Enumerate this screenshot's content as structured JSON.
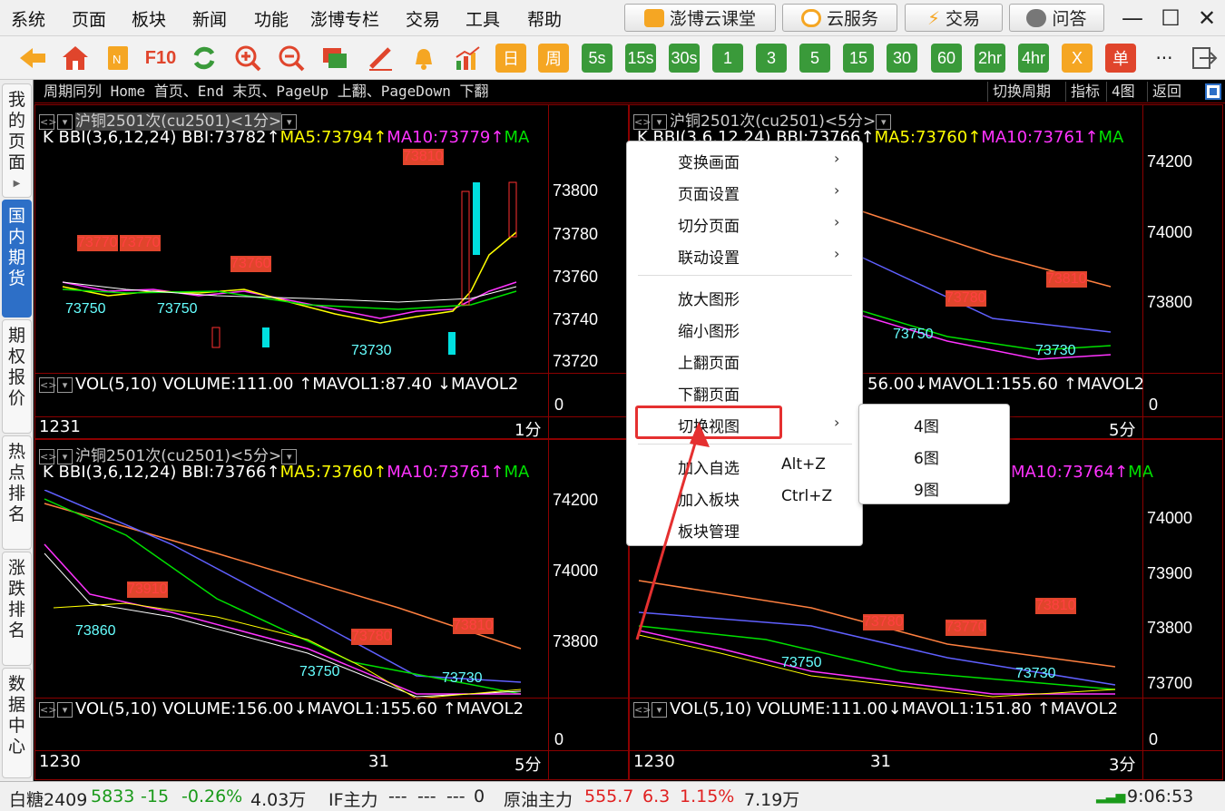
{
  "menu": [
    "系统",
    "页面",
    "板块",
    "新闻",
    "功能",
    "澎博专栏",
    "交易",
    "工具",
    "帮助"
  ],
  "topbuttons": [
    "澎博云课堂",
    "云服务",
    "交易",
    "问答"
  ],
  "toolbar": {
    "icons": [
      "back-arrow-icon",
      "home-icon",
      "notepad-icon",
      "f10-icon",
      "refresh-icon",
      "zoom-in-icon",
      "zoom-out-icon",
      "window-icon",
      "pen-icon",
      "bell-icon",
      "chart-up-icon"
    ],
    "f10": "F10",
    "periods": [
      "日",
      "周",
      "5s",
      "15s",
      "30s",
      "1",
      "3",
      "5",
      "15",
      "30",
      "60",
      "2hr",
      "4hr"
    ],
    "x": "X",
    "dan": "单",
    "more": "···"
  },
  "lefttabs": [
    "我的页面",
    "国内期货",
    "期权报价",
    "热点排名",
    "涨跌排名",
    "数据中心"
  ],
  "hint": {
    "text": "周期同列 Home 首页、End 末页、PageUp 上翻、PageDown 下翻",
    "buttons": [
      "切换周期",
      "指标",
      "4图",
      "返回"
    ]
  },
  "panels": [
    {
      "title": "沪铜2501次(cu2501)<1分>",
      "bbi": "K BBI(3,6,12,24) BBI:73782↑",
      "ma5": "MA5:73794↑",
      "ma10": "MA10:73779↑",
      "mx": "MA",
      "prices": [
        "73800",
        "73780",
        "73760",
        "73740",
        "73720"
      ],
      "labels_r": [
        "73810",
        "73770",
        "73770",
        "73760"
      ],
      "labels_c": [
        "73750",
        "73750",
        "73730"
      ],
      "vol": "VOL(5,10) VOLUME:111.00 ↑MAVOL1:87.40 ↓MAVOL2",
      "vzero": "0",
      "date": "1231",
      "period": "1分"
    },
    {
      "title": "沪铜2501次(cu2501)<5分>",
      "bbi": "K BBI(3,6,12,24) BBI:73766↑",
      "ma5": "MA5:73760↑",
      "ma10": "MA10:73761↑",
      "mx": "MA",
      "prices": [
        "74200",
        "74000",
        "73800"
      ],
      "labels_r": [
        "73780",
        "73810"
      ],
      "labels_c": [
        "73750",
        "73730"
      ],
      "vol": "56.00↓MAVOL1:155.60 ↑MAVOL2",
      "vzero": "0",
      "date": "",
      "period": "5分"
    },
    {
      "title": "沪铜2501次(cu2501)<5分>",
      "bbi": "K BBI(3,6,12,24) BBI:73766↑",
      "ma5": "MA5:73760↑",
      "ma10": "MA10:73761↑",
      "mx": "MA",
      "prices": [
        "74200",
        "74000",
        "73800"
      ],
      "labels_r": [
        "73910",
        "73780",
        "73810"
      ],
      "labels_c": [
        "73860",
        "73750",
        "73730"
      ],
      "vol": "VOL(5,10) VOLUME:156.00↓MAVOL1:155.60 ↑MAVOL2",
      "vzero": "0",
      "date": "1230",
      "date2": "31",
      "period": "5分"
    },
    {
      "title": "",
      "bbi": "",
      "ma5": "",
      "ma10": "MA10:73764↑",
      "mx": "MA",
      "prices": [
        "74000",
        "73900",
        "73800",
        "73700"
      ],
      "labels_r": [
        "73780",
        "73770",
        "73810"
      ],
      "labels_c": [
        "73750",
        "73730"
      ],
      "vol": "VOL(5,10) VOLUME:111.00↓MAVOL1:151.80 ↑MAVOL2",
      "vzero": "0",
      "date": "1230",
      "date2": "31",
      "period": "3分"
    }
  ],
  "ctxmenu": {
    "items": [
      "变换画面",
      "页面设置",
      "切分页面",
      "联动设置",
      "放大图形",
      "缩小图形",
      "上翻页面",
      "下翻页面",
      "切换视图",
      "加入自选",
      "加入板块",
      "板块管理"
    ],
    "shortcuts": [
      "Alt+Z",
      "Ctrl+Z"
    ],
    "submenu": [
      "4图",
      "6图",
      "9图"
    ]
  },
  "status": {
    "items": [
      {
        "name": "白糖2409",
        "price": "5833",
        "chg": "-15",
        "pct": "-0.26%",
        "vol": "4.03万"
      },
      {
        "name": "IF主力",
        "price": "---",
        "chg": "---",
        "pct": "---",
        "vol": "0"
      },
      {
        "name": "原油主力",
        "price": "555.7",
        "chg": "6.3",
        "pct": "1.15%",
        "vol": "7.19万"
      }
    ],
    "time": "9:06:53"
  },
  "colors": {
    "up": "#ff3030",
    "down": "#00e0e0",
    "ma5": "#ffff00",
    "ma10": "#ff33ff",
    "ma20": "#00e000",
    "accent": "#2d6fc7",
    "highlight": "#e53030"
  }
}
